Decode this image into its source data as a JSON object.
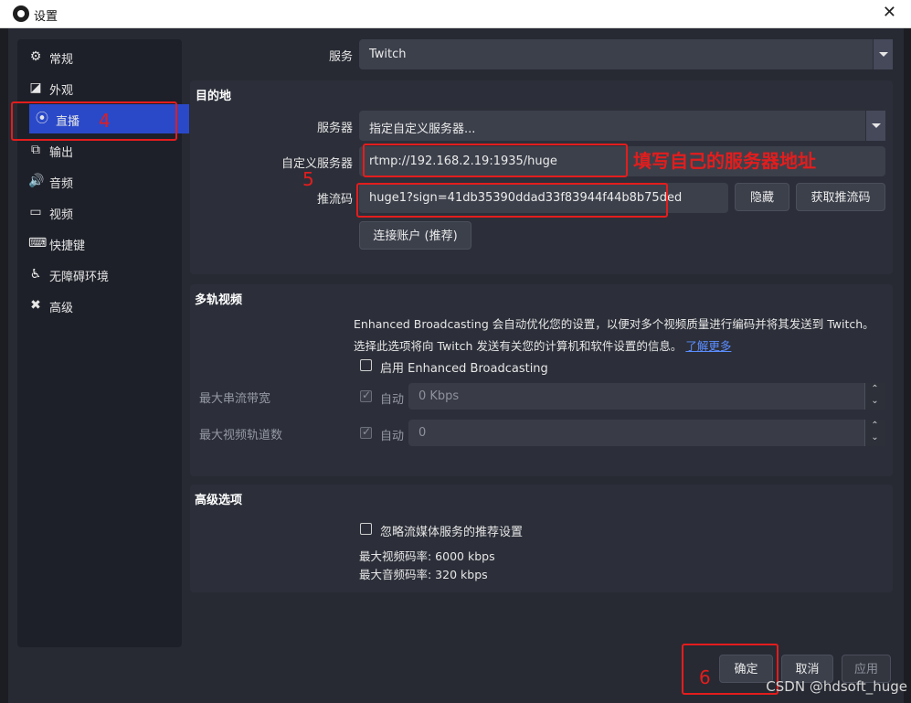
{
  "window": {
    "title": "设置"
  },
  "sidebar": {
    "items": [
      {
        "label": "常规",
        "icon": "gear-icon",
        "glyph": "⚙"
      },
      {
        "label": "外观",
        "icon": "appearance-icon",
        "glyph": "◪"
      },
      {
        "label": "直播",
        "icon": "broadcast-icon",
        "glyph": "⦿"
      },
      {
        "label": "输出",
        "icon": "output-icon",
        "glyph": "⧉"
      },
      {
        "label": "音频",
        "icon": "speaker-icon",
        "glyph": "🔊"
      },
      {
        "label": "视频",
        "icon": "monitor-icon",
        "glyph": "▭"
      },
      {
        "label": "快捷键",
        "icon": "keyboard-icon",
        "glyph": "⌨"
      },
      {
        "label": "无障碍环境",
        "icon": "accessibility-icon",
        "glyph": "♿"
      },
      {
        "label": "高级",
        "icon": "tools-icon",
        "glyph": "✖"
      }
    ],
    "active_index": 2
  },
  "service": {
    "label": "服务",
    "value": "Twitch"
  },
  "destination": {
    "title": "目的地",
    "server_label": "服务器",
    "server_value": "指定自定义服务器...",
    "custom_server_label": "自定义服务器",
    "custom_server_value": "rtmp://192.168.2.19:1935/huge",
    "stream_key_label": "推流码",
    "stream_key_value": "huge1?sign=41db35390ddad33f83944f44b8b75ded",
    "hide_button": "隐藏",
    "get_key_button": "获取推流码",
    "connect_account_button": "连接账户 (推荐)"
  },
  "multitrack": {
    "title": "多轨视频",
    "description_line1": "Enhanced Broadcasting 会自动优化您的设置，以便对多个视频质量进行编码并将其发送到 Twitch。",
    "description_line2": "选择此选项将向 Twitch 发送有关您的计算机和软件设置的信息。",
    "learn_more": "了解更多",
    "enable_label": "启用 Enhanced Broadcasting",
    "max_bandwidth_label": "最大串流带宽",
    "max_bandwidth_auto": "自动",
    "max_bandwidth_value": "0 Kbps",
    "max_tracks_label": "最大视频轨道数",
    "max_tracks_auto": "自动",
    "max_tracks_value": "0"
  },
  "advanced": {
    "title": "高级选项",
    "ignore_label": "忽略流媒体服务的推荐设置",
    "max_video_bitrate": "最大视频码率: 6000 kbps",
    "max_audio_bitrate": "最大音频码率: 320 kbps"
  },
  "footer": {
    "ok": "确定",
    "cancel": "取消",
    "apply": "应用"
  },
  "annotations": {
    "n4": "4",
    "n5": "5",
    "n6": "6",
    "note": "填写自己的服务器地址",
    "color": "#e31d1d"
  },
  "watermark": "CSDN @hdsoft_huge"
}
